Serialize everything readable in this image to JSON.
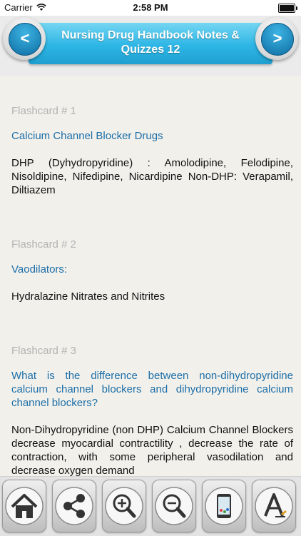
{
  "status_bar": {
    "carrier": "Carrier",
    "time": "2:58 PM"
  },
  "header": {
    "title": "Nursing Drug Handbook Notes & Quizzes 12",
    "prev_icon": "<",
    "next_icon": ">"
  },
  "flashcards": [
    {
      "label": "Flashcard # 1",
      "question": "Calcium Channel Blocker Drugs",
      "answer": "DHP (Dyhydropyridine) : Amolodipine, Felodipine, Nisoldipine, Nifedipine, Nicardipine Non-DHP: Verapamil, Diltiazem"
    },
    {
      "label": "Flashcard # 2",
      "question": "Vaodilators:",
      "answer": "Hydralazine Nitrates and Nitrites"
    },
    {
      "label": "Flashcard # 3",
      "question": "What is the difference between non-dihydropyridine calcium channel blockers and dihydropyridine calcium channel blockers?",
      "answer": "Non-Dihydropyridine (non DHP) Calcium Channel Blockers decrease myocardial contractility , decrease the rate of contraction, with some peripheral vasodilation and decrease oxygen demand"
    }
  ],
  "toolbar": {
    "icons": [
      "home-icon",
      "share-icon",
      "zoom-in-icon",
      "zoom-out-icon",
      "phone-settings-icon",
      "font-icon"
    ]
  },
  "colors": {
    "banner": "#2db6e5",
    "question_text": "#1d6fa8",
    "label_text": "#b3b3b3",
    "nav_button": "#1a7fb3"
  }
}
